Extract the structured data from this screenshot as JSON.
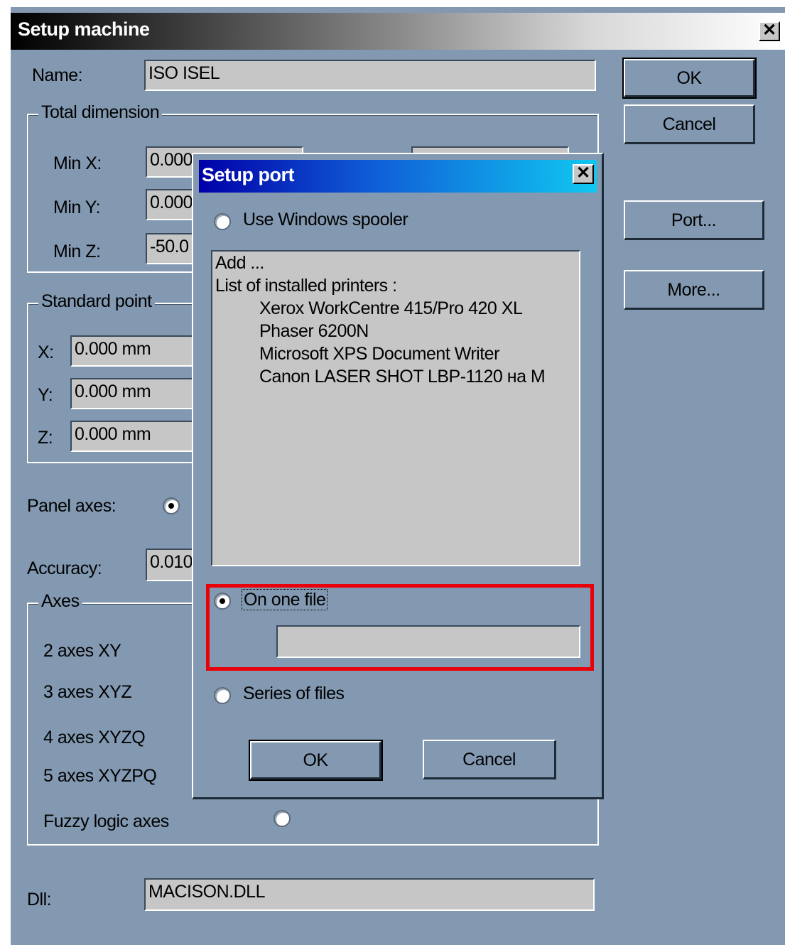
{
  "main_dialog": {
    "title": "Setup machine",
    "close_glyph": "✕",
    "name_label": "Name:",
    "name_value": "ISO ISEL",
    "ok_label": "OK",
    "cancel_label": "Cancel",
    "port_label": "Port...",
    "more_label": "More...",
    "total_dimension": {
      "title": "Total dimension",
      "minx_label": "Min X:",
      "minx_value": "0.000",
      "miny_label": "Min Y:",
      "miny_value": "0.000",
      "minz_label": "Min Z:",
      "minz_value": "-50.0"
    },
    "standard_point": {
      "title": "Standard point",
      "x_label": "X:",
      "x_value": "0.000 mm",
      "y_label": "Y:",
      "y_value": "0.000 mm",
      "z_label": "Z:",
      "z_value": "0.000 mm"
    },
    "panel_axes_label": "Panel axes:",
    "accuracy_label": "Accuracy:",
    "accuracy_value": "0.010",
    "axes": {
      "title": "Axes",
      "items": [
        "2 axes XY",
        "3 axes XYZ",
        "4 axes XYZQ",
        "5 axes XYZPQ",
        "Fuzzy logic axes"
      ]
    },
    "dll_label": "Dll:",
    "dll_value": "MACISON.DLL"
  },
  "port_dialog": {
    "title": "Setup port",
    "close_glyph": "✕",
    "use_spooler_label": "Use Windows spooler",
    "printers_list": {
      "items": [
        "Add ...",
        "List of installed printers :"
      ],
      "printers": [
        "Xerox WorkCentre 415/Pro 420 XL",
        "Phaser 6200N",
        "Microsoft XPS Document Writer",
        "Canon LASER SHOT LBP-1120 на M"
      ]
    },
    "one_file_label": "On one file",
    "one_file_value": "",
    "series_label": "Series of files",
    "ok_label": "OK",
    "cancel_label": "Cancel",
    "selected_option": "On one file"
  },
  "annotation": {
    "highlight_color": "#e8000a"
  },
  "colors": {
    "dialog_bg": "#8299b1",
    "field_bg": "#c6c6c6",
    "port_title_start": "#0000a8",
    "port_title_end": "#10c8f0"
  }
}
